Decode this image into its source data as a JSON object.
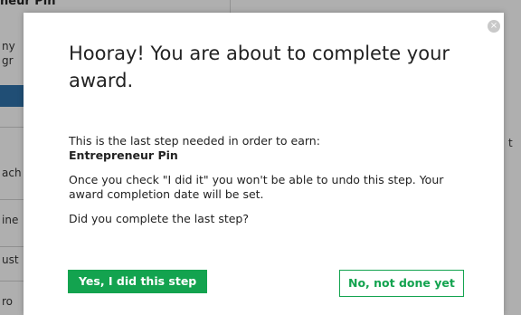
{
  "background": {
    "top_fragment": "neur Pin\"",
    "left_fragments": [
      "ny",
      "gr",
      "ach",
      "ine",
      "ust",
      "ro"
    ],
    "right_fragment": "t"
  },
  "modal": {
    "close_icon": "×",
    "title": "Hooray! You are about to complete your award.",
    "intro": "This is the last step needed in order to earn:",
    "award_name": "Entrepreneur Pin",
    "warning": "Once you check \"I did it\" you won't be able to undo this step. Your award completion date will be set.",
    "question": "Did you complete the last step?",
    "yes_label": "Yes, I did this step",
    "no_label": "No, not done yet"
  },
  "colors": {
    "accent_green": "#13a34f",
    "background_blue": "#2d6ca2"
  }
}
